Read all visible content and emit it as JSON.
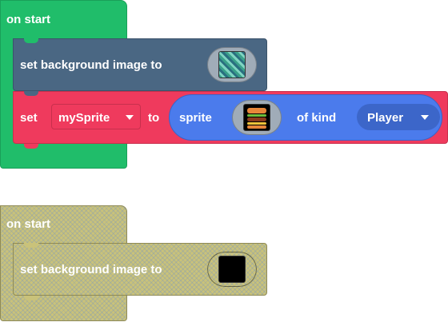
{
  "stack1": {
    "hat_label": "on start",
    "set_bg_label": "set background image to",
    "set_label": "set",
    "variable": "mySprite",
    "to_label": "to",
    "sprite_label": "sprite",
    "of_kind_label": "of kind",
    "kind_value": "Player"
  },
  "stack2": {
    "hat_label": "on start",
    "set_bg_label": "set background image to"
  },
  "colors": {
    "events_green": "#20bd6a",
    "scene_blue": "#4a6783",
    "variables_red": "#ef3a5d",
    "sprites_blue": "#4b7bec",
    "disabled_yellow": "#c9c27a"
  }
}
